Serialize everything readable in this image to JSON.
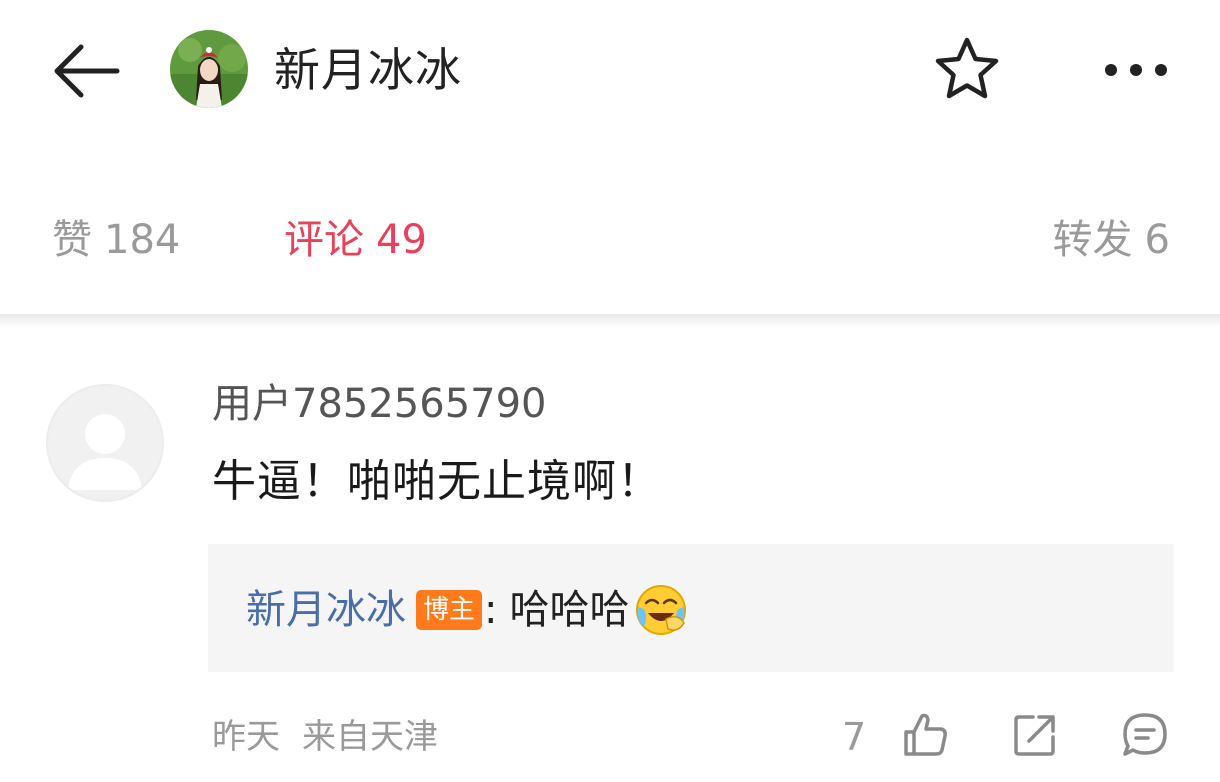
{
  "header": {
    "title": "新月冰冰",
    "icons": {
      "back": "back-arrow-icon",
      "favorite": "star-icon",
      "more": "more-dots-icon"
    }
  },
  "tabs": [
    {
      "label": "赞",
      "count": "184",
      "active": false
    },
    {
      "label": "评论",
      "count": "49",
      "active": true
    },
    {
      "label": "转发",
      "count": "6",
      "active": false
    }
  ],
  "comment": {
    "username": "用户7852565790",
    "text": "牛逼！啪啪无止境啊！",
    "reply": {
      "author": "新月冰冰",
      "badge": "博主",
      "colon": ":",
      "text": "哈哈哈",
      "emoji": "laughing-crying-emoji"
    },
    "meta": {
      "time": "昨天",
      "source": "来自天津"
    },
    "likes": "7"
  },
  "colors": {
    "active_tab": "#e8415c",
    "inactive_tab": "#9a9a9a",
    "reply_author": "#4a6ea8",
    "badge_bg": "#ff7a1a",
    "reply_bg": "#f5f5f5"
  }
}
